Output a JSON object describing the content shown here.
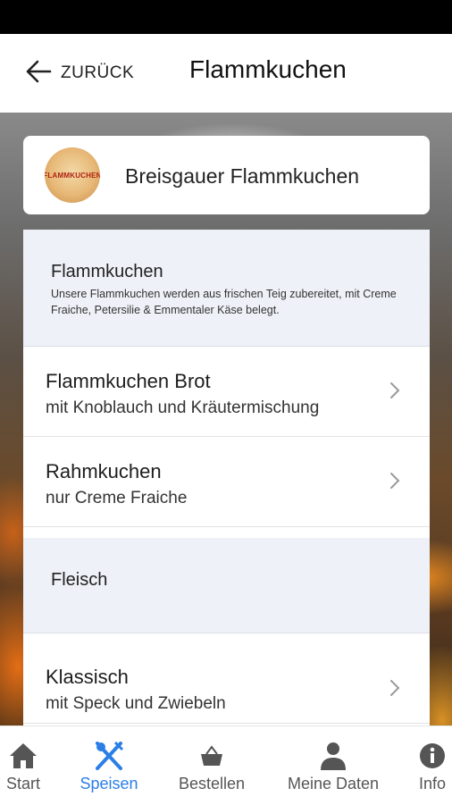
{
  "header": {
    "back_label": "ZURÜCK",
    "title": "Flammkuchen"
  },
  "restaurant": {
    "name": "Breisgauer Flammkuchen",
    "logo_text": "FLAMMKUCHEN"
  },
  "sections": [
    {
      "title": "Flammkuchen",
      "description": "Unsere Flammkuchen werden aus frischen Teig zubereitet, mit Creme Fraiche, Petersilie & Emmentaler Käse belegt.",
      "items": [
        {
          "name": "Flammkuchen Brot",
          "subtitle": "mit Knoblauch und Kräutermischung"
        },
        {
          "name": "Rahmkuchen",
          "subtitle": "nur Creme Fraiche"
        }
      ]
    },
    {
      "title": "Fleisch",
      "description": "",
      "items": [
        {
          "name": "Klassisch",
          "subtitle": "mit Speck und Zwiebeln"
        }
      ]
    }
  ],
  "nav": {
    "items": [
      {
        "label": "Start",
        "icon": "home-icon"
      },
      {
        "label": "Speisen",
        "icon": "cutlery-icon",
        "active": true
      },
      {
        "label": "Bestellen",
        "icon": "basket-icon"
      },
      {
        "label": "Meine Daten",
        "icon": "person-icon"
      },
      {
        "label": "Info",
        "icon": "info-icon"
      }
    ],
    "active_color": "#2a7fe6",
    "inactive_color": "#555555"
  }
}
